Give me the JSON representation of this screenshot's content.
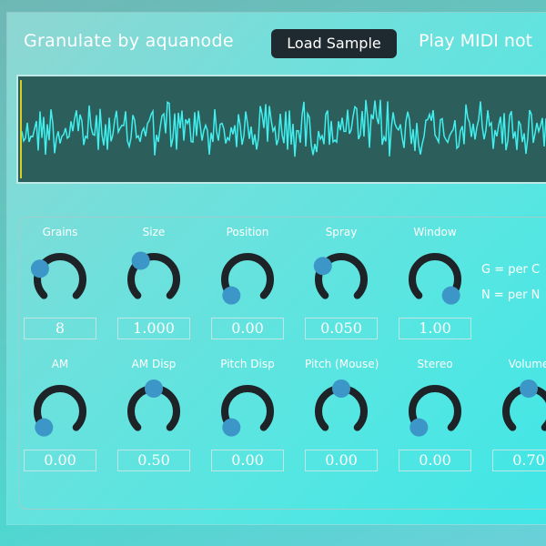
{
  "header": {
    "title": "Granulate by aquanode",
    "load_button": "Load Sample",
    "midi_label": "Play MIDI not"
  },
  "info": {
    "line1": "G = per C",
    "line2": "N = per N"
  },
  "knobs_row1": [
    {
      "label": "Grains",
      "value": "8",
      "level": 0.27
    },
    {
      "label": "Size",
      "value": "1.000",
      "level": 0.37
    },
    {
      "label": "Position",
      "value": "0.00",
      "level": 0.0
    },
    {
      "label": "Spray",
      "value": "0.050",
      "level": 0.3
    },
    {
      "label": "Window",
      "value": "1.00",
      "level": 1.0
    }
  ],
  "knobs_row2": [
    {
      "label": "AM",
      "value": "0.00",
      "level": 0.0
    },
    {
      "label": "AM Disp",
      "value": "0.50",
      "level": 0.5
    },
    {
      "label": "Pitch Disp",
      "value": "0.00",
      "level": 0.0
    },
    {
      "label": "Pitch (Mouse)",
      "value": "0.00",
      "level": 0.5
    },
    {
      "label": "Stereo",
      "value": "0.00",
      "level": 0.0
    },
    {
      "label": "Volume",
      "value": "0.70",
      "level": 0.5
    }
  ],
  "colors": {
    "knob_track": "#1d2327",
    "knob_handle": "#3d96c8",
    "waveform_bg": "#2c5e5c",
    "waveform_line": "#3ff0ee",
    "playhead": "#d8d020"
  }
}
